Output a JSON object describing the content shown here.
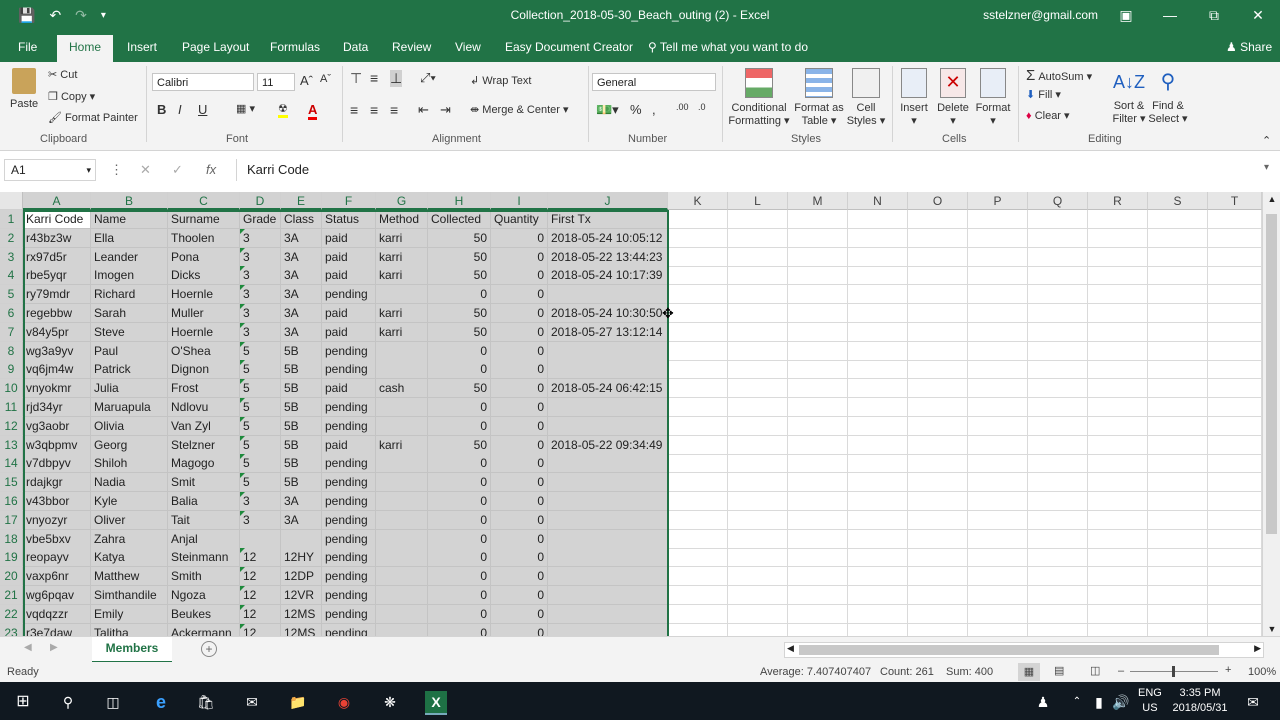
{
  "app": {
    "title": "Collection_2018-05-30_Beach_outing (2)  -  Excel",
    "user": "sstelzner@gmail.com",
    "accent_color": "#217346"
  },
  "qat": {
    "save_icon": "save-icon",
    "undo_icon": "undo-icon",
    "redo_icon": "redo-icon"
  },
  "tabs": [
    "File",
    "Home",
    "Insert",
    "Page Layout",
    "Formulas",
    "Data",
    "Review",
    "View",
    "Easy Document Creator"
  ],
  "tell_me": "Tell me what you want to do",
  "share": "Share",
  "ribbon": {
    "clipboard": {
      "paste": "Paste",
      "cut": "Cut",
      "copy": "Copy",
      "format_painter": "Format Painter",
      "label": "Clipboard"
    },
    "font": {
      "name": "Calibri",
      "size": "11",
      "label": "Font",
      "bold": "B",
      "italic": "I",
      "underline": "U"
    },
    "alignment": {
      "wrap": "Wrap Text",
      "merge": "Merge & Center",
      "label": "Alignment"
    },
    "number": {
      "format": "General",
      "label": "Number"
    },
    "styles": {
      "conditional": "Conditional",
      "conditional2": "Formatting",
      "format_table": "Format as",
      "format_table2": "Table",
      "cell_styles": "Cell",
      "cell_styles2": "Styles",
      "label": "Styles"
    },
    "cells": {
      "insert": "Insert",
      "delete": "Delete",
      "format": "Format",
      "label": "Cells"
    },
    "editing": {
      "autosum": "AutoSum",
      "fill": "Fill",
      "clear": "Clear",
      "sort": "Sort &",
      "sort2": "Filter",
      "find": "Find &",
      "find2": "Select",
      "label": "Editing"
    }
  },
  "formula_bar": {
    "name_box": "A1",
    "fx": "fx",
    "value": "Karri Code"
  },
  "columns": [
    "A",
    "B",
    "C",
    "D",
    "E",
    "F",
    "G",
    "H",
    "I",
    "J",
    "K",
    "L",
    "M",
    "N",
    "O",
    "P",
    "Q",
    "R",
    "S",
    "T"
  ],
  "rows": [
    [
      "Karri Code",
      "Name",
      "Surname",
      "Grade",
      "Class",
      "Status",
      "Method",
      "Collected",
      "Quantity",
      "First Tx"
    ],
    [
      "r43bz3w",
      "Ella",
      "Thoolen",
      "3",
      "3A",
      "paid",
      "karri",
      "50",
      "0",
      "2018-05-24 10:05:12"
    ],
    [
      "rx97d5r",
      "Leander",
      "Pona",
      "3",
      "3A",
      "paid",
      "karri",
      "50",
      "0",
      "2018-05-22 13:44:23"
    ],
    [
      "rbe5yqr",
      "Imogen",
      "Dicks",
      "3",
      "3A",
      "paid",
      "karri",
      "50",
      "0",
      "2018-05-24 10:17:39"
    ],
    [
      "ry79mdr",
      "Richard",
      "Hoernle",
      "3",
      "3A",
      "pending",
      "",
      "0",
      "0",
      ""
    ],
    [
      "regebbw",
      "Sarah",
      "Muller",
      "3",
      "3A",
      "paid",
      "karri",
      "50",
      "0",
      "2018-05-24 10:30:50"
    ],
    [
      "v84y5pr",
      "Steve",
      "Hoernle",
      "3",
      "3A",
      "paid",
      "karri",
      "50",
      "0",
      "2018-05-27 13:12:14"
    ],
    [
      "wg3a9yv",
      "Paul",
      "O'Shea",
      "5",
      "5B",
      "pending",
      "",
      "0",
      "0",
      ""
    ],
    [
      "vq6jm4w",
      "Patrick",
      "Dignon",
      "5",
      "5B",
      "pending",
      "",
      "0",
      "0",
      ""
    ],
    [
      "vnyokmr",
      "Julia",
      "Frost",
      "5",
      "5B",
      "paid",
      "cash",
      "50",
      "0",
      "2018-05-24 06:42:15"
    ],
    [
      "rjd34yr",
      "Maruapula",
      "Ndlovu",
      "5",
      "5B",
      "pending",
      "",
      "0",
      "0",
      ""
    ],
    [
      "vg3aobr",
      "Olivia",
      "Van Zyl",
      "5",
      "5B",
      "pending",
      "",
      "0",
      "0",
      ""
    ],
    [
      "w3qbpmv",
      "Georg",
      "Stelzner",
      "5",
      "5B",
      "paid",
      "karri",
      "50",
      "0",
      "2018-05-22 09:34:49"
    ],
    [
      "v7dbpyv",
      "Shiloh",
      "Magogo",
      "5",
      "5B",
      "pending",
      "",
      "0",
      "0",
      ""
    ],
    [
      "rdajkgr",
      "Nadia",
      "Smit",
      "5",
      "5B",
      "pending",
      "",
      "0",
      "0",
      ""
    ],
    [
      "v43bbor",
      "Kyle",
      "Balia",
      "3",
      "3A",
      "pending",
      "",
      "0",
      "0",
      ""
    ],
    [
      "vnyozyr",
      "Oliver",
      "Tait",
      "3",
      "3A",
      "pending",
      "",
      "0",
      "0",
      ""
    ],
    [
      "vbe5bxv",
      "Zahra",
      "Anjal",
      "",
      "",
      "pending",
      "",
      "0",
      "0",
      ""
    ],
    [
      "reopayv",
      "Katya",
      "Steinmann",
      "12",
      "12HY",
      "pending",
      "",
      "0",
      "0",
      ""
    ],
    [
      "vaxp6nr",
      "Matthew",
      "Smith",
      "12",
      "12DP",
      "pending",
      "",
      "0",
      "0",
      ""
    ],
    [
      "wg6pqav",
      "Simthandile",
      "Ngoza",
      "12",
      "12VR",
      "pending",
      "",
      "0",
      "0",
      ""
    ],
    [
      "vqdqzzr",
      "Emily",
      "Beukes",
      "12",
      "12MS",
      "pending",
      "",
      "0",
      "0",
      ""
    ],
    [
      "r3e7daw",
      "Talitha",
      "Ackermann",
      "12",
      "12MS",
      "pending",
      "",
      "0",
      "0",
      ""
    ]
  ],
  "sheet_tab": "Members",
  "status": {
    "ready": "Ready",
    "average": "Average: 7.407407407",
    "count": "Count: 261",
    "sum": "Sum: 400",
    "zoom": "100%"
  },
  "taskbar": {
    "lang": "ENG",
    "region": "US",
    "time": "3:35 PM",
    "date": "2018/05/31"
  }
}
